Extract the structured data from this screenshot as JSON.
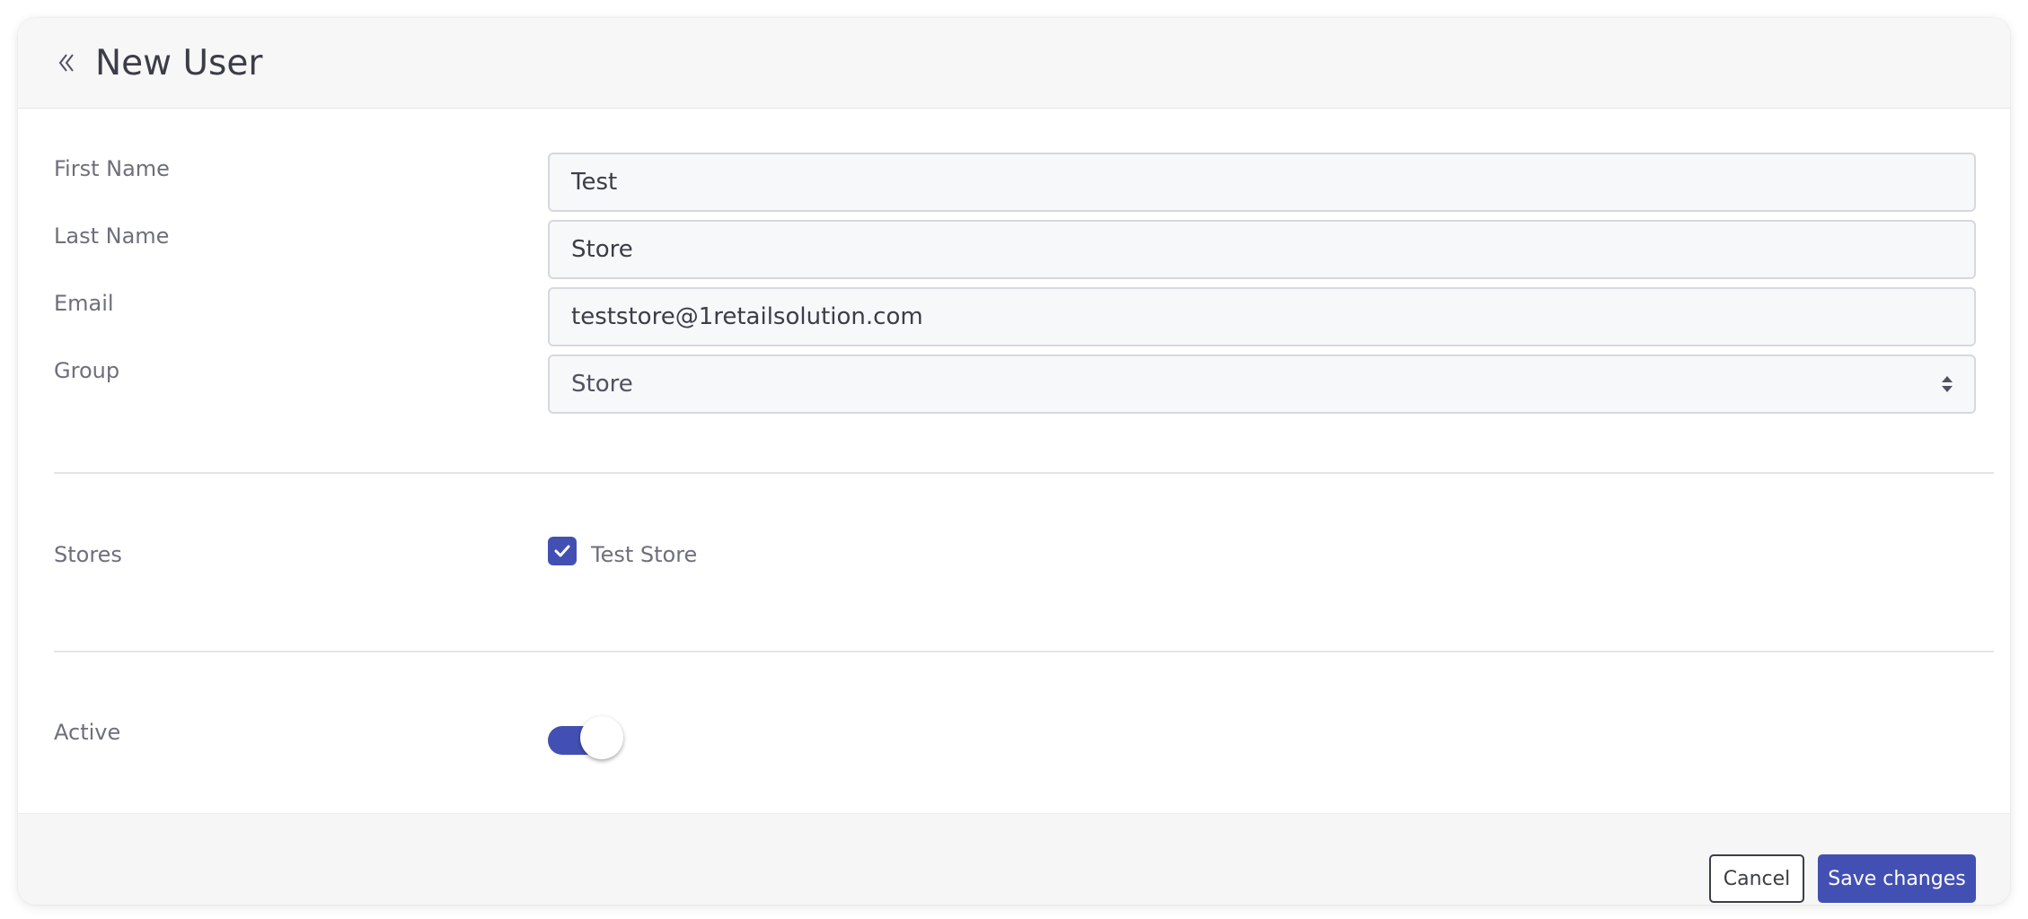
{
  "header": {
    "title": "New User",
    "back_icon": "double-chevron-left-icon"
  },
  "form": {
    "first_name": {
      "label": "First Name",
      "value": "Test"
    },
    "last_name": {
      "label": "Last Name",
      "value": "Store"
    },
    "email": {
      "label": "Email",
      "value": "teststore@1retailsolution.com"
    },
    "group": {
      "label": "Group",
      "value": "Store",
      "icon": "sort-arrows-icon"
    },
    "stores": {
      "label": "Stores",
      "options": [
        {
          "label": "Test Store",
          "checked": true
        }
      ]
    },
    "active": {
      "label": "Active",
      "enabled": true
    }
  },
  "footer": {
    "cancel_label": "Cancel",
    "save_label": "Save changes"
  },
  "colors": {
    "accent": "#4350b3",
    "text": "#3b3d47",
    "label": "#6d6f7b",
    "header_bg": "#f7f7f8"
  }
}
